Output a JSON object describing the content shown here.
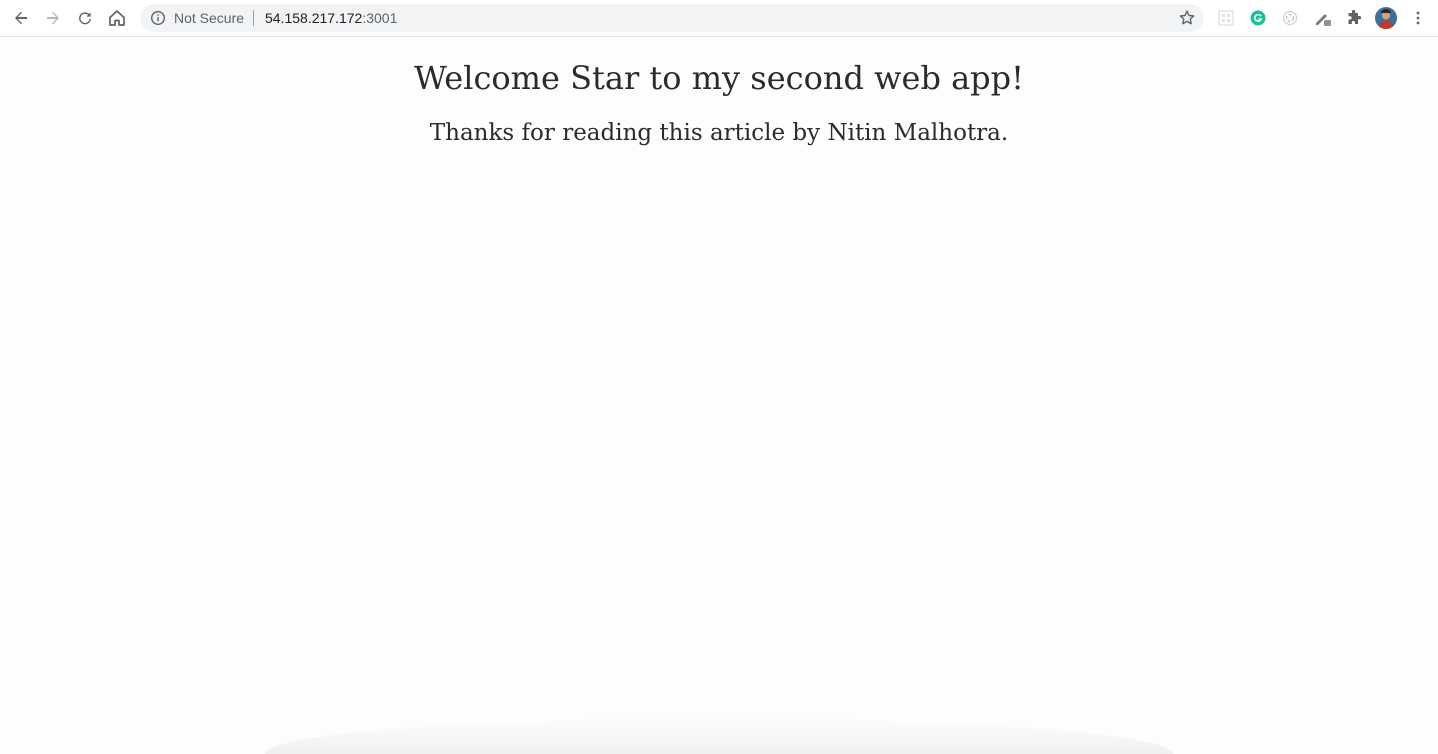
{
  "browser": {
    "security_label": "Not Secure",
    "url_host": "54.158.217.172",
    "url_port": ":3001",
    "icons": {
      "back": "arrow-left-icon",
      "forward": "arrow-right-icon",
      "reload": "reload-icon",
      "home": "home-icon",
      "info": "info-icon",
      "bookmark": "star-icon",
      "extensions": [
        "grid-extension-icon",
        "grammarly-icon",
        "loader-extension-icon",
        "pen-extension-icon",
        "puzzle-icon"
      ],
      "profile": "avatar",
      "menu": "more-vert-icon"
    },
    "colors": {
      "grammarly": "#15c39a",
      "avatar": "#c0392b"
    }
  },
  "page": {
    "heading": "Welcome Star to my second web app!",
    "subheading": "Thanks for reading this article by Nitin Malhotra."
  }
}
